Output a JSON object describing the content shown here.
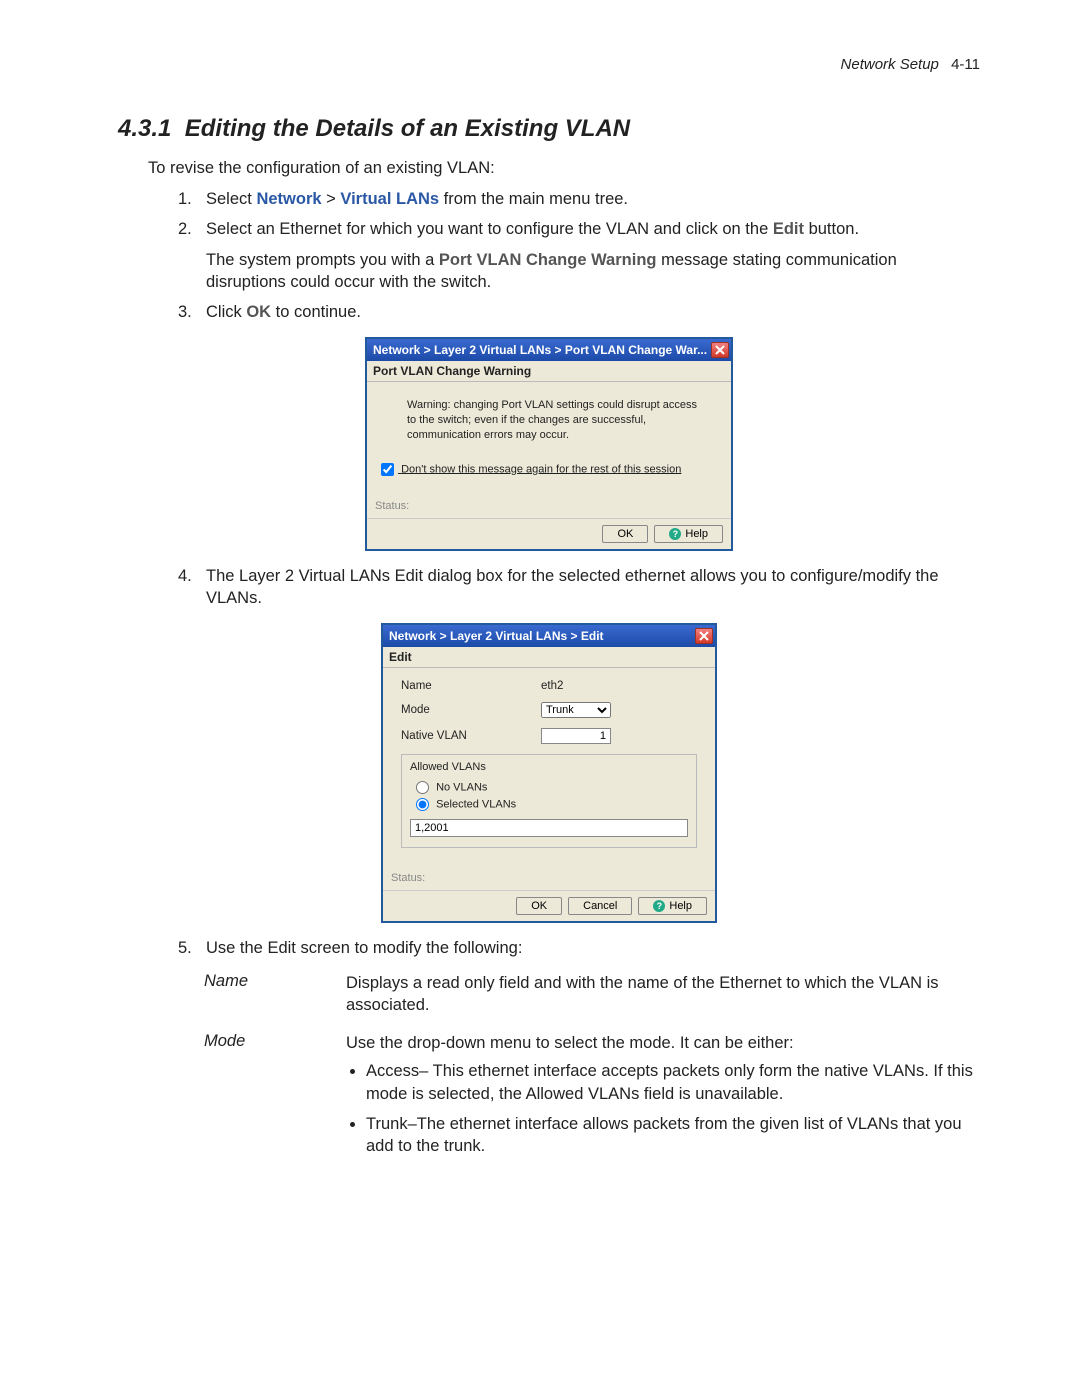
{
  "header": {
    "chapter": "Network Setup",
    "pageno": "4-11"
  },
  "section": {
    "number": "4.3.1",
    "title": "Editing the Details of an Existing VLAN"
  },
  "intro": "To revise the configuration of an existing VLAN:",
  "steps": {
    "s1": {
      "num": "1.",
      "pre": "Select ",
      "link1": "Network",
      "gt": " > ",
      "link2": "Virtual LANs",
      "post": " from the main menu tree."
    },
    "s2": {
      "num": "2.",
      "pre": "Select an Ethernet for which you want to configure the VLAN and click on the ",
      "btn": "Edit",
      "post": " button.",
      "sub_pre": "The system prompts you with a ",
      "sub_bold": "Port VLAN Change Warning",
      "sub_post": " message stating communication disruptions could occur with the switch."
    },
    "s3": {
      "num": "3.",
      "pre": "Click ",
      "btn": "OK",
      "post": " to continue."
    },
    "s4": {
      "num": "4.",
      "text": "The Layer 2 Virtual LANs Edit dialog box for the selected ethernet allows you to configure/modify the VLANs."
    },
    "s5": {
      "num": "5.",
      "text": "Use the Edit screen to modify the following:"
    }
  },
  "warn_dialog": {
    "title": "Network > Layer 2 Virtual LANs > Port VLAN Change War...",
    "subhead": "Port VLAN Change Warning",
    "body": "Warning: changing Port VLAN settings could disrupt access to the switch; even if the changes are successful, communication errors may occur.",
    "checkbox": "Don't show this message again for the rest of this session",
    "status": "Status:",
    "ok": "OK",
    "help": "Help"
  },
  "edit_dialog": {
    "title": "Network > Layer 2 Virtual LANs > Edit",
    "subhead": "Edit",
    "name_lbl": "Name",
    "name_val": "eth2",
    "mode_lbl": "Mode",
    "mode_val": "Trunk",
    "native_lbl": "Native VLAN",
    "native_val": "1",
    "group_title": "Allowed VLANs",
    "radio_none": "No VLANs",
    "radio_sel": "Selected VLANs",
    "allowed_val": "1,2001",
    "status": "Status:",
    "ok": "OK",
    "cancel": "Cancel",
    "help": "Help"
  },
  "defs": {
    "name": {
      "term": "Name",
      "text": "Displays a read only field and with the name of the Ethernet to which the VLAN is associated."
    },
    "mode": {
      "term": "Mode",
      "text": "Use the drop-down menu to select the mode. It can be either:",
      "b1": "Access– This ethernet interface accepts packets only form the native VLANs. If this mode is selected, the Allowed VLANs field is unavailable.",
      "b2": "Trunk–The ethernet interface allows packets from the given list of VLANs that you add to the trunk."
    }
  }
}
